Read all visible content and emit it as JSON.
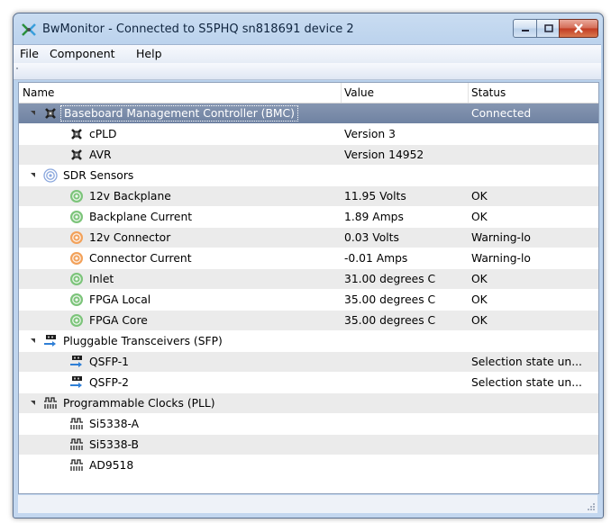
{
  "window": {
    "title": "BwMonitor - Connected to S5PHQ sn818691 device 2"
  },
  "menu": [
    "File",
    "Component",
    "Help"
  ],
  "columns": [
    "Name",
    "Value",
    "Status"
  ],
  "rows": [
    {
      "level": 0,
      "expanded": true,
      "icon": "bmc-chip-icon",
      "name": "Baseboard Management Controller (BMC)",
      "value": "",
      "status": "Connected",
      "selected": true
    },
    {
      "level": 1,
      "icon": "bmc-chip-icon",
      "name": "cPLD",
      "value": "Version 3",
      "status": ""
    },
    {
      "level": 1,
      "icon": "bmc-chip-icon",
      "name": "AVR",
      "value": "Version 14952",
      "status": ""
    },
    {
      "level": 0,
      "expanded": true,
      "icon": "sensor-icon",
      "name": "SDR Sensors",
      "value": "",
      "status": ""
    },
    {
      "level": 1,
      "icon": "sensor-ok-icon",
      "name": "12v Backplane",
      "value": "11.95 Volts",
      "status": "OK"
    },
    {
      "level": 1,
      "icon": "sensor-ok-icon",
      "name": "Backplane Current",
      "value": "1.89 Amps",
      "status": "OK"
    },
    {
      "level": 1,
      "icon": "sensor-warning-icon",
      "name": "12v Connector",
      "value": "0.03 Volts",
      "status": "Warning-lo"
    },
    {
      "level": 1,
      "icon": "sensor-warning-icon",
      "name": "Connector Current",
      "value": "-0.01 Amps",
      "status": "Warning-lo"
    },
    {
      "level": 1,
      "icon": "sensor-ok-icon",
      "name": "Inlet",
      "value": "31.00 degrees C",
      "status": "OK"
    },
    {
      "level": 1,
      "icon": "sensor-ok-icon",
      "name": "FPGA Local",
      "value": "35.00 degrees C",
      "status": "OK"
    },
    {
      "level": 1,
      "icon": "sensor-ok-icon",
      "name": "FPGA Core",
      "value": "35.00 degrees C",
      "status": "OK"
    },
    {
      "level": 0,
      "expanded": true,
      "icon": "transceiver-icon",
      "name": "Pluggable Transceivers (SFP)",
      "value": "",
      "status": ""
    },
    {
      "level": 1,
      "icon": "transceiver-icon",
      "name": "QSFP-1",
      "value": "",
      "status": "Selection state un..."
    },
    {
      "level": 1,
      "icon": "transceiver-icon",
      "name": "QSFP-2",
      "value": "",
      "status": "Selection state un..."
    },
    {
      "level": 0,
      "expanded": true,
      "icon": "clock-icon",
      "name": "Programmable Clocks (PLL)",
      "value": "",
      "status": ""
    },
    {
      "level": 1,
      "icon": "clock-icon",
      "name": "Si5338-A",
      "value": "",
      "status": ""
    },
    {
      "level": 1,
      "icon": "clock-icon",
      "name": "Si5338-B",
      "value": "",
      "status": ""
    },
    {
      "level": 1,
      "icon": "clock-icon",
      "name": "AD9518",
      "value": "",
      "status": ""
    }
  ],
  "colors": {
    "ok": "#7cc47a",
    "warning": "#f2a15a",
    "sensor": "#8aa7dd",
    "selected": "#7a8ba8",
    "transceiver_arrow": "#2f7fd6"
  }
}
